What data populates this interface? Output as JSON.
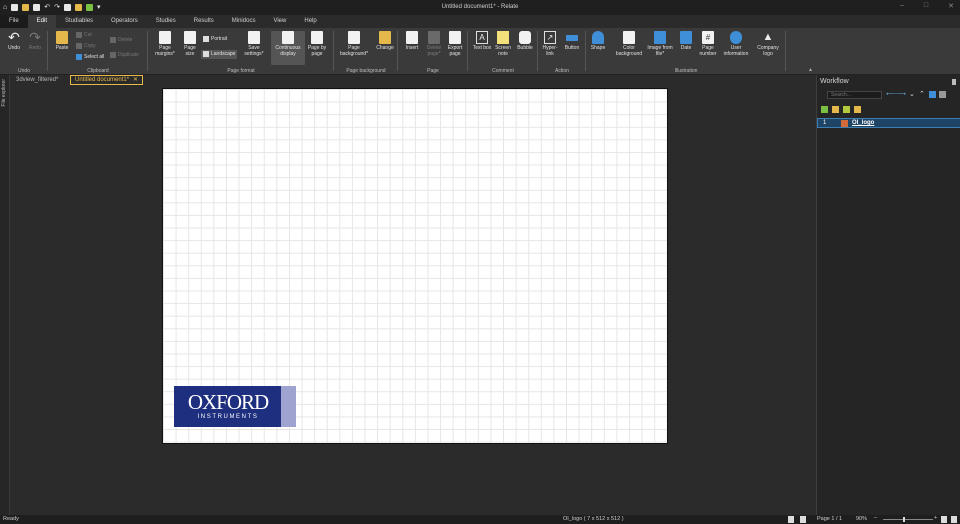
{
  "app": {
    "title": "Untitled document1* - Relate",
    "window_controls": [
      "–",
      "□",
      "✕"
    ]
  },
  "menu": {
    "tabs": [
      "File",
      "Edit",
      "Studiables",
      "Operators",
      "Studies",
      "Results",
      "Minidocs",
      "View",
      "Help"
    ],
    "active": "Edit"
  },
  "ribbon": {
    "undo": {
      "undo": "Undo",
      "redo": "Redo",
      "group": "Undo"
    },
    "clipboard": {
      "paste": "Paste",
      "cut": "Cut",
      "copy": "Copy",
      "select_all": "Select all",
      "delete": "Delete",
      "duplicate": "Duplicate",
      "group": "Clipboard"
    },
    "page_format": {
      "margins": "Page margins*",
      "size": "Page size",
      "portrait": "Portrait",
      "landscape": "Landscape",
      "save_settings": "Save settings*",
      "continuous": "Continuous display",
      "page_by_page": "Page by page",
      "group": "Page format"
    },
    "page_background": {
      "background": "Page background*",
      "change": "Change",
      "group": "Page background"
    },
    "page": {
      "insert": "Insert",
      "delete_page": "Delete page*",
      "export_page": "Export page",
      "group": "Page"
    },
    "comment": {
      "text_box": "Text box",
      "screen_note": "Screen note",
      "bubble": "Bubble",
      "group": "Comment"
    },
    "action": {
      "hyperlink": "Hyper- link",
      "button": "Button",
      "group": "Action"
    },
    "illustration": {
      "shape": "Shape",
      "color_background": "Color background",
      "image_from_file": "Image from file*",
      "date": "Date",
      "page_number": "Page number",
      "user_information": "User information",
      "company_logo": "Company logo",
      "group": "Illustration"
    }
  },
  "doc_tabs": [
    "3dview_filtered*",
    "Untitled document1*"
  ],
  "left_strip": {
    "label": "File explorer"
  },
  "logo": {
    "line1": "OXFORD",
    "line2": "INSTRUMENTS"
  },
  "workflow": {
    "title": "Workflow",
    "search_placeholder": "Search...",
    "items": [
      {
        "index": "1",
        "name": "OI_logo"
      }
    ]
  },
  "status": {
    "left": "Ready",
    "center": "OI_logo ( 7 x 512 x 512 )",
    "page": "Page 1 / 1",
    "zoom": "90%",
    "zoom_minus": "–",
    "zoom_plus": "+"
  }
}
